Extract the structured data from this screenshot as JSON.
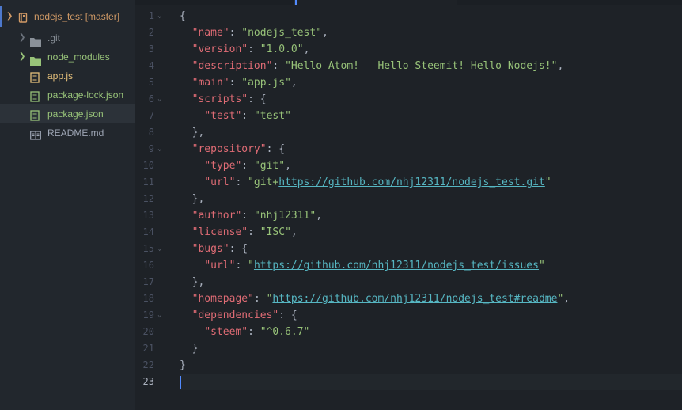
{
  "sidebar": {
    "root": {
      "label": "nodejs_test [master]",
      "expanded": true
    },
    "items": [
      {
        "label": ".git",
        "type": "folder",
        "icon": "folder-icon",
        "color": "#8a9199",
        "expanded": false
      },
      {
        "label": "node_modules",
        "type": "folder",
        "icon": "folder-icon",
        "color": "#98c379",
        "expanded": false
      },
      {
        "label": "app.js",
        "type": "file",
        "icon": "js-file-icon",
        "color": "#e5c07b"
      },
      {
        "label": "package-lock.json",
        "type": "file",
        "icon": "json-file-icon",
        "color": "#98c379"
      },
      {
        "label": "package.json",
        "type": "file",
        "icon": "json-file-icon",
        "color": "#98c379",
        "selected": true
      },
      {
        "label": "README.md",
        "type": "file",
        "icon": "markdown-file-icon",
        "color": "#9da5b4"
      }
    ]
  },
  "editor": {
    "cursor_line": 23,
    "lines": [
      {
        "n": "1",
        "fold": true,
        "tokens": [
          [
            "p",
            "{"
          ]
        ]
      },
      {
        "n": "2",
        "tokens": [
          [
            "p",
            "  "
          ],
          [
            "k",
            "\"name\""
          ],
          [
            "p",
            ": "
          ],
          [
            "s",
            "\"nodejs_test\""
          ],
          [
            "p",
            ","
          ]
        ]
      },
      {
        "n": "3",
        "tokens": [
          [
            "p",
            "  "
          ],
          [
            "k",
            "\"version\""
          ],
          [
            "p",
            ": "
          ],
          [
            "s",
            "\"1.0.0\""
          ],
          [
            "p",
            ","
          ]
        ]
      },
      {
        "n": "4",
        "tokens": [
          [
            "p",
            "  "
          ],
          [
            "k",
            "\"description\""
          ],
          [
            "p",
            ": "
          ],
          [
            "s",
            "\"Hello Atom!   Hello Steemit! Hello Nodejs!\""
          ],
          [
            "p",
            ","
          ]
        ]
      },
      {
        "n": "5",
        "tokens": [
          [
            "p",
            "  "
          ],
          [
            "k",
            "\"main\""
          ],
          [
            "p",
            ": "
          ],
          [
            "s",
            "\"app.js\""
          ],
          [
            "p",
            ","
          ]
        ]
      },
      {
        "n": "6",
        "fold": true,
        "tokens": [
          [
            "p",
            "  "
          ],
          [
            "k",
            "\"scripts\""
          ],
          [
            "p",
            ": {"
          ]
        ]
      },
      {
        "n": "7",
        "tokens": [
          [
            "p",
            "    "
          ],
          [
            "k",
            "\"test\""
          ],
          [
            "p",
            ": "
          ],
          [
            "s",
            "\"test\""
          ]
        ]
      },
      {
        "n": "8",
        "tokens": [
          [
            "p",
            "  },"
          ]
        ]
      },
      {
        "n": "9",
        "fold": true,
        "tokens": [
          [
            "p",
            "  "
          ],
          [
            "k",
            "\"repository\""
          ],
          [
            "p",
            ": {"
          ]
        ]
      },
      {
        "n": "10",
        "tokens": [
          [
            "p",
            "    "
          ],
          [
            "k",
            "\"type\""
          ],
          [
            "p",
            ": "
          ],
          [
            "s",
            "\"git\""
          ],
          [
            "p",
            ","
          ]
        ]
      },
      {
        "n": "11",
        "tokens": [
          [
            "p",
            "    "
          ],
          [
            "k",
            "\"url\""
          ],
          [
            "p",
            ": "
          ],
          [
            "s",
            "\"git+"
          ],
          [
            "u",
            "https://github.com/nhj12311/nodejs_test.git"
          ],
          [
            "s",
            "\""
          ]
        ]
      },
      {
        "n": "12",
        "tokens": [
          [
            "p",
            "  },"
          ]
        ]
      },
      {
        "n": "13",
        "tokens": [
          [
            "p",
            "  "
          ],
          [
            "k",
            "\"author\""
          ],
          [
            "p",
            ": "
          ],
          [
            "s",
            "\"nhj12311\""
          ],
          [
            "p",
            ","
          ]
        ]
      },
      {
        "n": "14",
        "tokens": [
          [
            "p",
            "  "
          ],
          [
            "k",
            "\"license\""
          ],
          [
            "p",
            ": "
          ],
          [
            "s",
            "\"ISC\""
          ],
          [
            "p",
            ","
          ]
        ]
      },
      {
        "n": "15",
        "fold": true,
        "tokens": [
          [
            "p",
            "  "
          ],
          [
            "k",
            "\"bugs\""
          ],
          [
            "p",
            ": {"
          ]
        ]
      },
      {
        "n": "16",
        "tokens": [
          [
            "p",
            "    "
          ],
          [
            "k",
            "\"url\""
          ],
          [
            "p",
            ": "
          ],
          [
            "s",
            "\""
          ],
          [
            "u",
            "https://github.com/nhj12311/nodejs_test/issues"
          ],
          [
            "s",
            "\""
          ]
        ]
      },
      {
        "n": "17",
        "tokens": [
          [
            "p",
            "  },"
          ]
        ]
      },
      {
        "n": "18",
        "tokens": [
          [
            "p",
            "  "
          ],
          [
            "k",
            "\"homepage\""
          ],
          [
            "p",
            ": "
          ],
          [
            "s",
            "\""
          ],
          [
            "u",
            "https://github.com/nhj12311/nodejs_test#readme"
          ],
          [
            "s",
            "\""
          ],
          [
            "p",
            ","
          ]
        ]
      },
      {
        "n": "19",
        "fold": true,
        "tokens": [
          [
            "p",
            "  "
          ],
          [
            "k",
            "\"dependencies\""
          ],
          [
            "p",
            ": {"
          ]
        ]
      },
      {
        "n": "20",
        "tokens": [
          [
            "p",
            "    "
          ],
          [
            "k",
            "\"steem\""
          ],
          [
            "p",
            ": "
          ],
          [
            "s",
            "\"^0.6.7\""
          ]
        ]
      },
      {
        "n": "21",
        "tokens": [
          [
            "p",
            "  }"
          ]
        ]
      },
      {
        "n": "22",
        "tokens": [
          [
            "p",
            "}"
          ]
        ]
      },
      {
        "n": "23",
        "tokens": []
      }
    ]
  }
}
